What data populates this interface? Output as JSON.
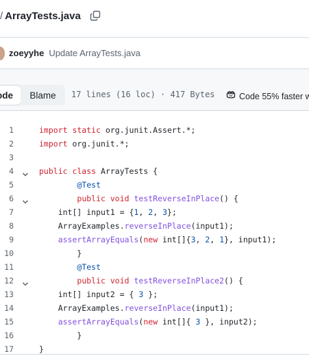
{
  "breadcrumb": {
    "separator": "/",
    "filename": "ArrayTests.java"
  },
  "icons": {
    "copy": "copy-icon",
    "fold": "chevron-down-icon",
    "copilot": "copilot-icon"
  },
  "commit": {
    "author": "zoeyyhe",
    "message": "Update ArrayTests.java"
  },
  "toolbar": {
    "code_label": "Code",
    "blame_label": "Blame",
    "file_info": "17 lines (16 loc) · 417 Bytes",
    "copilot_text": "Code 55% faster wi"
  },
  "code": {
    "foldable_lines": [
      4,
      6,
      12
    ],
    "lines": [
      {
        "n": "1",
        "tokens": [
          {
            "t": "import static ",
            "c": "kw"
          },
          {
            "t": "org.junit.Assert.*;",
            "c": ""
          }
        ]
      },
      {
        "n": "2",
        "tokens": [
          {
            "t": "import ",
            "c": "kw"
          },
          {
            "t": "org.junit.*;",
            "c": ""
          }
        ]
      },
      {
        "n": "3",
        "tokens": []
      },
      {
        "n": "4",
        "tokens": [
          {
            "t": "public class ",
            "c": "kw"
          },
          {
            "t": "ArrayTests {",
            "c": ""
          }
        ]
      },
      {
        "n": "5",
        "tokens": [
          {
            "t": "        ",
            "c": ""
          },
          {
            "t": "@Test",
            "c": "an"
          }
        ]
      },
      {
        "n": "6",
        "tokens": [
          {
            "t": "        ",
            "c": ""
          },
          {
            "t": "public void ",
            "c": "kw"
          },
          {
            "t": "testReverseInPlace",
            "c": "fn"
          },
          {
            "t": "() {",
            "c": ""
          }
        ]
      },
      {
        "n": "7",
        "tokens": [
          {
            "t": "    int[] input1 = {",
            "c": ""
          },
          {
            "t": "1",
            "c": "num"
          },
          {
            "t": ", ",
            "c": ""
          },
          {
            "t": "2",
            "c": "num"
          },
          {
            "t": ", ",
            "c": ""
          },
          {
            "t": "3",
            "c": "num"
          },
          {
            "t": "};",
            "c": ""
          }
        ]
      },
      {
        "n": "8",
        "tokens": [
          {
            "t": "    ArrayExamples.",
            "c": ""
          },
          {
            "t": "reverseInPlace",
            "c": "fn"
          },
          {
            "t": "(input1);",
            "c": ""
          }
        ]
      },
      {
        "n": "9",
        "tokens": [
          {
            "t": "    ",
            "c": ""
          },
          {
            "t": "assertArrayEquals",
            "c": "fn"
          },
          {
            "t": "(",
            "c": ""
          },
          {
            "t": "new ",
            "c": "kw"
          },
          {
            "t": "int[]{",
            "c": ""
          },
          {
            "t": "3",
            "c": "num"
          },
          {
            "t": ", ",
            "c": ""
          },
          {
            "t": "2",
            "c": "num"
          },
          {
            "t": ", ",
            "c": ""
          },
          {
            "t": "1",
            "c": "num"
          },
          {
            "t": "}, input1);",
            "c": ""
          }
        ]
      },
      {
        "n": "10",
        "tokens": [
          {
            "t": "        }",
            "c": ""
          }
        ]
      },
      {
        "n": "11",
        "tokens": [
          {
            "t": "        ",
            "c": ""
          },
          {
            "t": "@Test",
            "c": "an"
          }
        ]
      },
      {
        "n": "12",
        "tokens": [
          {
            "t": "        ",
            "c": ""
          },
          {
            "t": "public void ",
            "c": "kw"
          },
          {
            "t": "testReverseInPlace2",
            "c": "fn"
          },
          {
            "t": "() {",
            "c": ""
          }
        ]
      },
      {
        "n": "13",
        "tokens": [
          {
            "t": "    int[] input2 = { ",
            "c": ""
          },
          {
            "t": "3",
            "c": "num"
          },
          {
            "t": " };",
            "c": ""
          }
        ]
      },
      {
        "n": "14",
        "tokens": [
          {
            "t": "    ArrayExamples.",
            "c": ""
          },
          {
            "t": "reverseInPlace",
            "c": "fn"
          },
          {
            "t": "(input1);",
            "c": ""
          }
        ]
      },
      {
        "n": "15",
        "tokens": [
          {
            "t": "    ",
            "c": ""
          },
          {
            "t": "assertArrayEquals",
            "c": "fn"
          },
          {
            "t": "(",
            "c": ""
          },
          {
            "t": "new ",
            "c": "kw"
          },
          {
            "t": "int[]{ ",
            "c": ""
          },
          {
            "t": "3",
            "c": "num"
          },
          {
            "t": " }, input2);",
            "c": ""
          }
        ]
      },
      {
        "n": "16",
        "tokens": [
          {
            "t": "        }",
            "c": ""
          }
        ]
      },
      {
        "n": "17",
        "tokens": [
          {
            "t": "}",
            "c": ""
          }
        ]
      }
    ]
  }
}
